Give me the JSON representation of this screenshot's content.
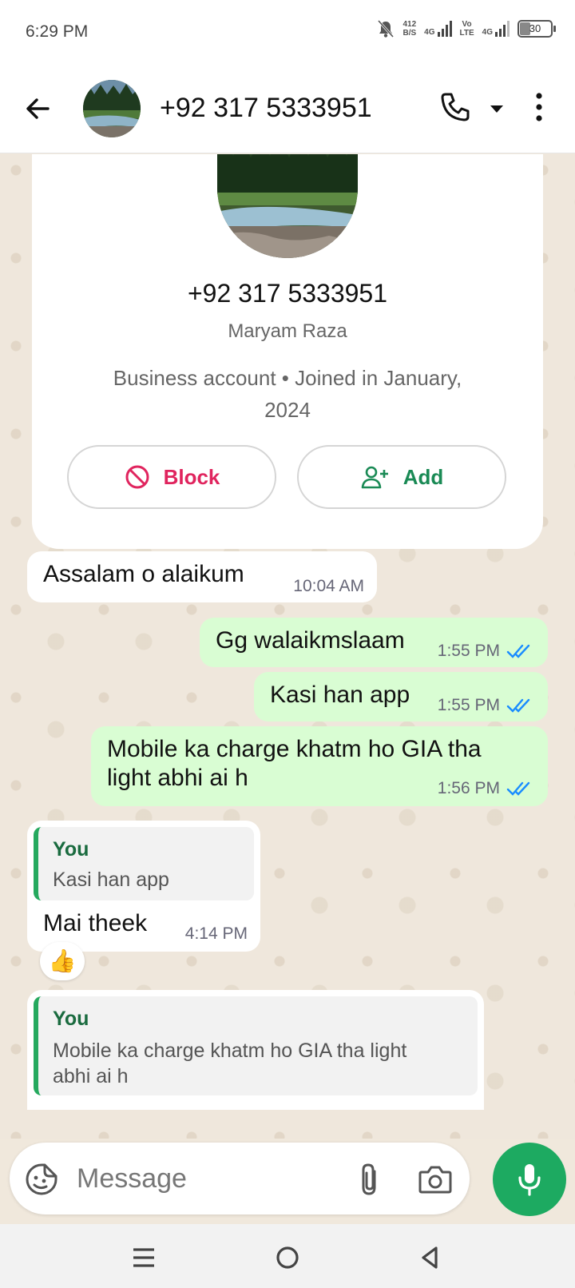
{
  "status_bar": {
    "time": "6:29 PM",
    "net_speed_value": "412",
    "net_speed_unit": "B/S",
    "sim1_label": "4G",
    "volte_top": "Vo",
    "volte_bottom": "LTE",
    "sim2_label": "4G",
    "battery": "30",
    "icons": [
      "bell-off-icon",
      "signal-icon",
      "battery-icon"
    ]
  },
  "header": {
    "title": "+92 317 5333951",
    "icons": [
      "back-arrow-icon",
      "phone-icon",
      "caret-down-icon",
      "more-vert-icon"
    ]
  },
  "profile": {
    "number": "+92 317 5333951",
    "name": "Maryam Raza",
    "meta": "Business account • Joined in January, 2024",
    "block_label": "Block",
    "add_label": "Add",
    "block_color": "#e0245e",
    "add_color": "#1a8a55"
  },
  "messages": [
    {
      "direction": "in",
      "text": "Assalam o alaikum",
      "time": "10:04 AM"
    },
    {
      "direction": "out",
      "text": "Gg walaikmslaam",
      "time": "1:55 PM",
      "status": "read"
    },
    {
      "direction": "out",
      "text": "Kasi han app",
      "time": "1:55 PM",
      "status": "read"
    },
    {
      "direction": "out",
      "text_line1": "Mobile ka charge khatm ho GIA tha",
      "text_line2": "light abhi ai h",
      "time": "1:56 PM",
      "status": "read"
    },
    {
      "direction": "in",
      "quote_author": "You",
      "quote_text": "Kasi han app",
      "text": "Mai theek",
      "time": "4:14 PM",
      "reaction": "👍"
    },
    {
      "direction": "in",
      "quote_author": "You",
      "quote_text_line1": "Mobile ka charge khatm ho GIA tha light",
      "quote_text_line2": "abhi ai h"
    }
  ],
  "input": {
    "placeholder": "Message",
    "icons": [
      "sticker-icon",
      "paperclip-icon",
      "camera-icon",
      "mic-icon"
    ]
  },
  "nav_bar": {
    "icons": [
      "menu-icon",
      "home-circle-icon",
      "back-triangle-icon"
    ]
  },
  "colors": {
    "outgoing_bubble": "#d9fdd3",
    "incoming_bubble": "#ffffff",
    "read_ticks": "#1a8cff",
    "mic_button": "#1daa61",
    "quote_bar": "#25a95e"
  }
}
